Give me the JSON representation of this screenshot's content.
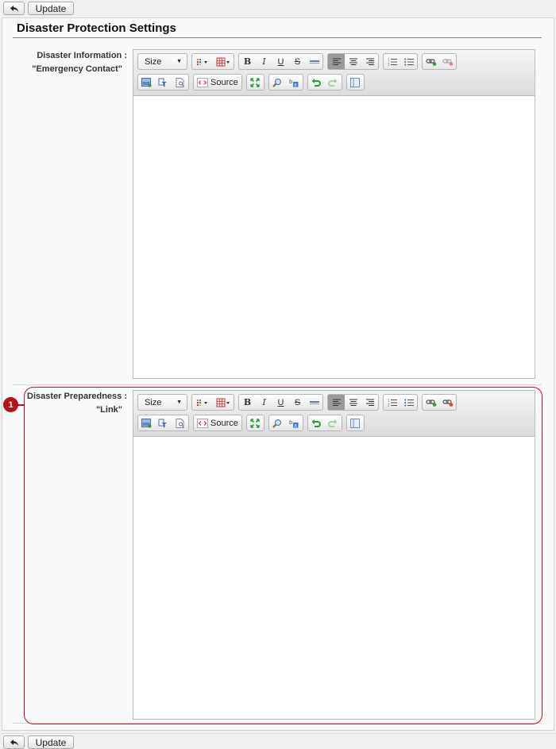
{
  "toolbar_top": {
    "back_icon": "back-arrow-icon",
    "update_label": "Update"
  },
  "toolbar_bottom": {
    "back_icon": "back-arrow-icon",
    "update_label": "Update"
  },
  "page": {
    "title": "Disaster Protection Settings"
  },
  "fields": [
    {
      "label_line1": "Disaster Information :",
      "label_line2": "\"Emergency Contact\""
    },
    {
      "label_line1": "Disaster Preparedness :",
      "label_line2": "\"Link\""
    }
  ],
  "editor_toolbar": {
    "size_label": "Size",
    "source_label": "Source",
    "icons": [
      "text-color-icon",
      "table-icon",
      "bold-icon",
      "italic-icon",
      "underline-icon",
      "strikethrough-icon",
      "horizontal-rule-icon",
      "align-left-icon",
      "align-center-icon",
      "align-right-icon",
      "numbered-list-icon",
      "bulleted-list-icon",
      "link-icon",
      "unlink-icon",
      "image-icon",
      "paste-text-icon",
      "preview-icon",
      "source-icon",
      "maximize-icon",
      "find-icon",
      "replace-icon",
      "undo-icon",
      "redo-icon",
      "show-blocks-icon"
    ]
  },
  "callout": {
    "number": "1",
    "color": "#c8102e"
  }
}
